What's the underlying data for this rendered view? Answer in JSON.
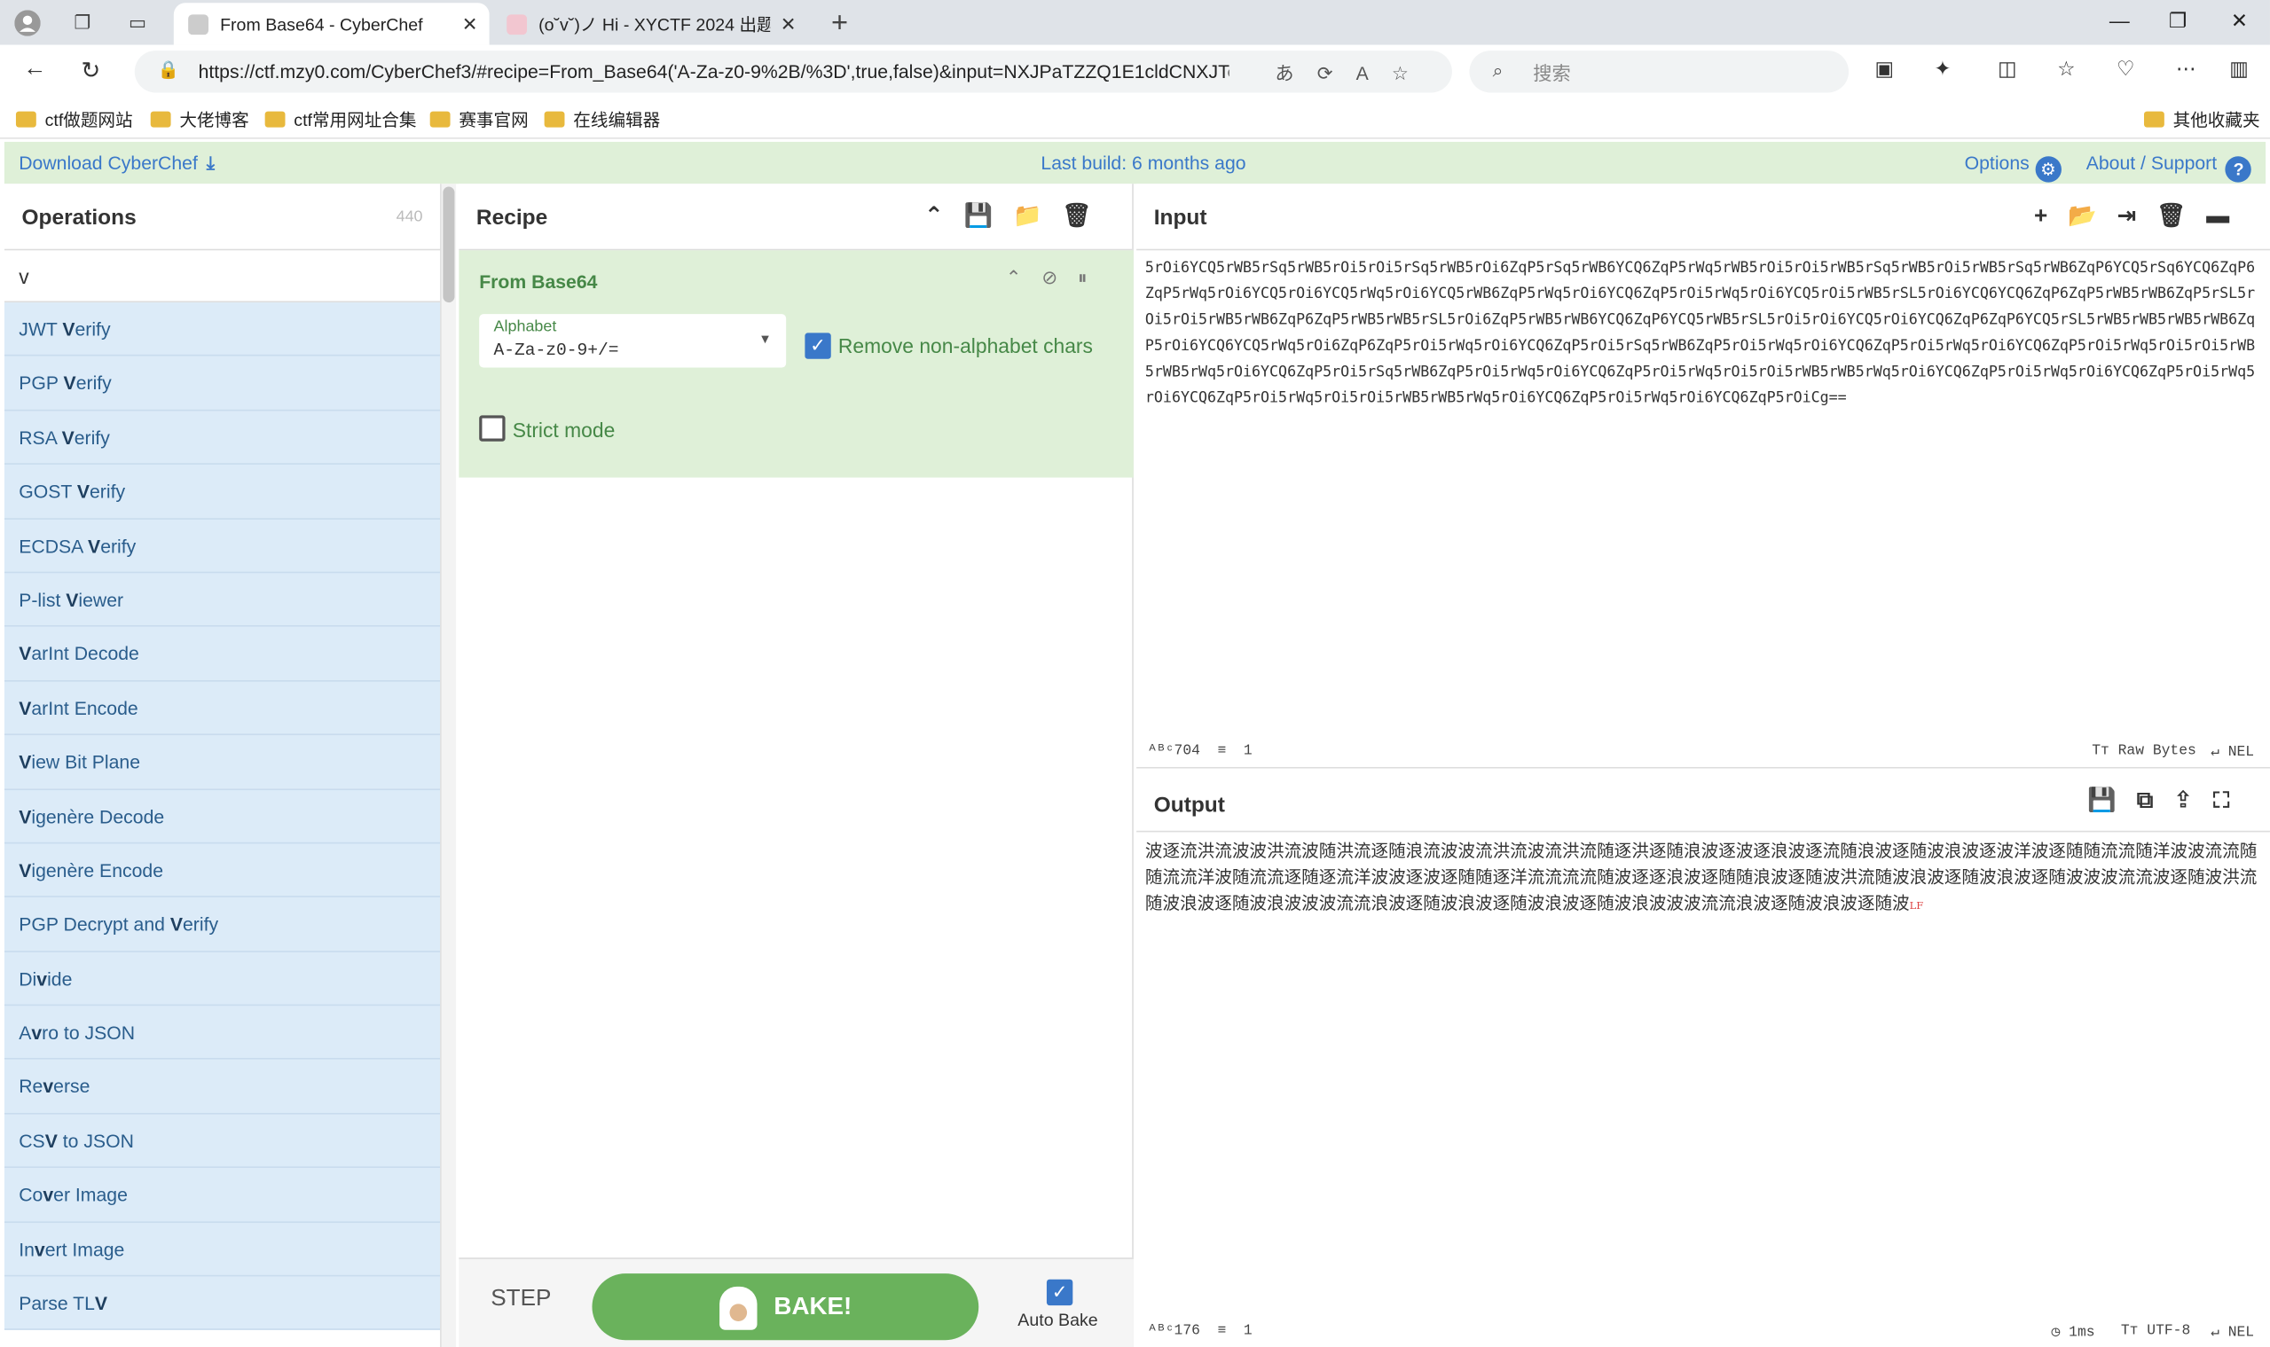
{
  "browser": {
    "tabs": [
      {
        "title": "From Base64 - CyberChef",
        "active": true
      },
      {
        "title": "(o˘v˘)ノ Hi - XYCTF 2024 出题记录",
        "active": false
      }
    ],
    "url": "https://ctf.mzy0.com/CyberChef3/#recipe=From_Base64('A-Za-z0-9%2B/%3D',true,false)&input=NXJPaTZZQ1E1cldCNXJTcT...",
    "search_placeholder": "搜索",
    "bookmarks": [
      "ctf做题网站",
      "大佬博客",
      "ctf常用网址合集",
      "赛事官网",
      "在线编辑器"
    ],
    "other_bookmarks": "其他收藏夹"
  },
  "banner": {
    "download": "Download CyberChef",
    "last_build": "Last build: 6 months ago",
    "options": "Options",
    "about": "About / Support"
  },
  "operations": {
    "title": "Operations",
    "count": "440",
    "search_value": "v",
    "items": [
      {
        "pre": "JWT ",
        "hl": "V",
        "post": "erify"
      },
      {
        "pre": "PGP ",
        "hl": "V",
        "post": "erify"
      },
      {
        "pre": "RSA ",
        "hl": "V",
        "post": "erify"
      },
      {
        "pre": "GOST ",
        "hl": "V",
        "post": "erify"
      },
      {
        "pre": "ECDSA ",
        "hl": "V",
        "post": "erify"
      },
      {
        "pre": "P-list ",
        "hl": "V",
        "post": "iewer"
      },
      {
        "pre": "",
        "hl": "V",
        "post": "arInt Decode"
      },
      {
        "pre": "",
        "hl": "V",
        "post": "arInt Encode"
      },
      {
        "pre": "",
        "hl": "V",
        "post": "iew Bit Plane"
      },
      {
        "pre": "",
        "hl": "V",
        "post": "igenère Decode"
      },
      {
        "pre": "",
        "hl": "V",
        "post": "igenère Encode"
      },
      {
        "pre": "PGP Decrypt and ",
        "hl": "V",
        "post": "erify"
      },
      {
        "pre": "Di",
        "hl": "v",
        "post": "ide"
      },
      {
        "pre": "A",
        "hl": "v",
        "post": "ro to JSON"
      },
      {
        "pre": "Re",
        "hl": "v",
        "post": "erse"
      },
      {
        "pre": "CS",
        "hl": "V",
        "post": " to JSON"
      },
      {
        "pre": "Co",
        "hl": "v",
        "post": "er Image"
      },
      {
        "pre": "In",
        "hl": "v",
        "post": "ert Image"
      },
      {
        "pre": "Parse TL",
        "hl": "V",
        "post": ""
      }
    ]
  },
  "recipe": {
    "title": "Recipe",
    "operation": {
      "name": "From Base64",
      "alphabet_label": "Alphabet",
      "alphabet_value": "A-Za-z0-9+/=",
      "remove_non_alpha_label": "Remove non-alphabet chars",
      "remove_non_alpha": true,
      "strict_mode_label": "Strict mode",
      "strict_mode": false
    },
    "step_label": "STEP",
    "bake_label": "BAKE!",
    "autobake_label": "Auto Bake",
    "autobake": true
  },
  "input": {
    "title": "Input",
    "text": "5rOi6YCQ5rWB5rSq5rWB5rOi5rOi5rSq5rWB5rOi6ZqP5rSq5rWB6YCQ6ZqP5rWq5rWB5rOi5rOi5rWB5rSq5rWB5rOi5rWB5rSq5rWB6ZqP6YCQ5rSq6YCQ6ZqP6ZqP5rWq5rOi6YCQ5rOi6YCQ5rWq5rOi6YCQ5rWB6ZqP5rWq5rOi6YCQ6ZqP5rOi5rWq5rOi6YCQ5rOi5rWB5rSL5rOi6YCQ6YCQ6ZqP6ZqP5rWB5rWB6ZqP5rSL5rOi5rOi5rWB5rWB6ZqP6ZqP5rWB5rWB5rSL5rOi6ZqP5rWB5rWB6YCQ6ZqP6YCQ5rWB5rSL5rOi5rOi6YCQ5rOi6YCQ6ZqP6ZqP6YCQ5rSL5rWB5rWB5rWB5rWB6ZqP5rOi6YCQ6YCQ5rWq5rOi6ZqP6ZqP5rOi5rWq5rOi6YCQ6ZqP5rOi5rSq5rWB6ZqP5rOi5rWq5rOi6YCQ6ZqP5rOi5rWq5rOi6YCQ6ZqP5rOi5rWq5rOi5rOi5rWB5rWB5rWq5rOi6YCQ6ZqP5rOi5rSq5rWB6ZqP5rOi5rWq5rOi6YCQ6ZqP5rOi5rWq5rOi5rOi5rWB5rWB5rWq5rOi6YCQ6ZqP5rOi5rWq5rOi6YCQ6ZqP5rOi5rWq5rOi6YCQ6ZqP5rOi5rWq5rOi5rOi5rWB5rWB5rWq5rOi6YCQ6ZqP5rOi5rWq5rOi6YCQ6ZqP5rOiCg==",
    "chars": "704",
    "lines": "1",
    "encoding": "Raw Bytes",
    "eol": "NEL"
  },
  "output": {
    "title": "Output",
    "text": "波逐流洪流波波洪流波随洪流逐随浪流波波流洪流波流洪流随逐洪逐随浪波逐波逐浪波逐流随浪波逐随波浪波逐波洋波逐随随流流随洋波波流流随随流流洋波随流流逐随逐流洋波波逐波逐随随逐洋流流流流随波逐逐浪波逐随随浪波逐随波洪流随波浪波逐随波浪波逐随波波波流流波逐随波洪流随波浪波逐随波浪波波波流流浪波逐随波浪波逐随波浪波逐随波浪波波波流流浪波逐随波浪波逐随波",
    "eol_marker": "LF",
    "chars": "176",
    "lines": "1",
    "time": "1ms",
    "encoding": "UTF-8",
    "eol": "NEL"
  }
}
